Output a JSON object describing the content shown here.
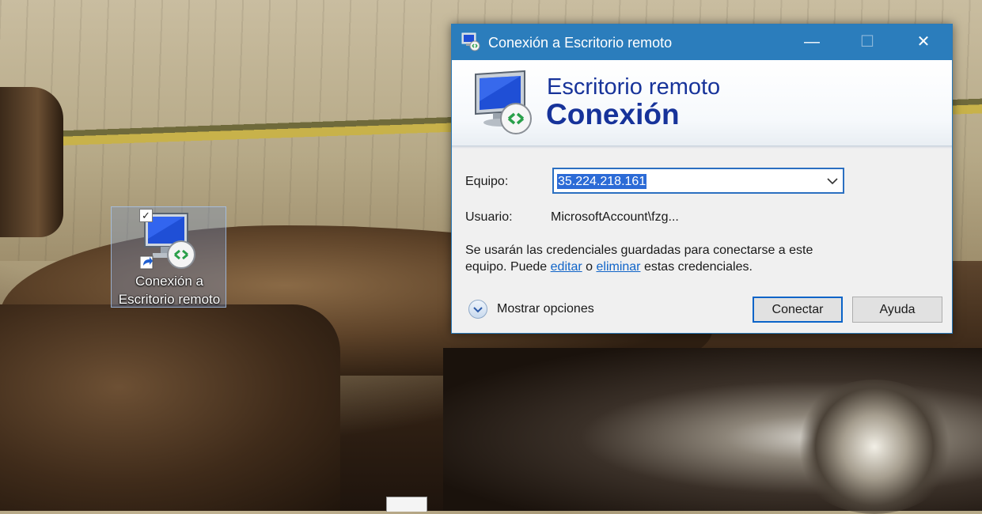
{
  "desktop": {
    "icon_label_line1": "Conexión a",
    "icon_label_line2": "Escritorio remoto",
    "checkbox_mark": "✓"
  },
  "dialog": {
    "title": "Conexión a Escritorio remoto",
    "window_buttons": {
      "minimize": "—",
      "maximize": "☐",
      "close": "✕"
    },
    "banner": {
      "line1": "Escritorio remoto",
      "line2": "Conexión"
    },
    "computer_label": "Equipo:",
    "computer_value": "35.224.218.161",
    "user_label": "Usuario:",
    "user_value": "MicrosoftAccount\\fzg...",
    "info_text_1": "Se usarán las credenciales guardadas para conectarse a este",
    "info_text_2": "equipo.  Puede ",
    "info_link_edit": "editar",
    "info_text_3": " o ",
    "info_link_delete": "eliminar",
    "info_text_4": " estas credenciales.",
    "show_options": "Mostrar opciones",
    "connect_button": "Conectar",
    "help_button": "Ayuda"
  },
  "icons": {
    "app": "remote-desktop-icon",
    "banner": "remote-desktop-monitor-icon",
    "desktop": "remote-desktop-shortcut-icon",
    "dropdown": "chevron-down-icon",
    "options": "expand-options-icon"
  },
  "colors": {
    "titlebar": "#2b7dbc",
    "banner_text": "#17339a",
    "selection": "#2c6bd6",
    "link": "#1064c8"
  }
}
